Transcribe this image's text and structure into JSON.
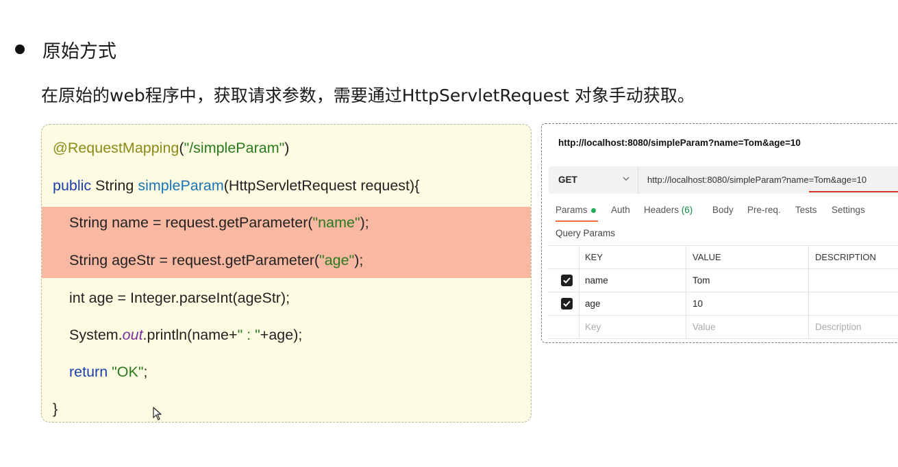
{
  "slide": {
    "heading": "原始方式",
    "description": "在原始的web程序中，获取请求参数，需要通过HttpServletRequest 对象手动获取。"
  },
  "code": {
    "line1_annotation": "@RequestMapping",
    "line1_paren_open": "(",
    "line1_string": "\"/simpleParam\"",
    "line1_paren_close": ")",
    "line2_kw": "public",
    "line2_type": " String ",
    "line2_method": "simpleParam",
    "line2_rest": "(HttpServletRequest request){",
    "line3_pre": "String name = request.getParameter(",
    "line3_str": "\"name\"",
    "line3_post": ");",
    "line4_pre": "String ageStr = request.getParameter(",
    "line4_str": "\"age\"",
    "line4_post": ");",
    "line5": "int age = Integer.parseInt(ageStr);",
    "line6_pre": "System.",
    "line6_field": "out",
    "line6_mid": ".println(name+",
    "line6_str": "\" : \"",
    "line6_post": "+age);",
    "line7_kw": "return",
    "line7_str": " \"OK\"",
    "line7_post": ";",
    "line8": "}"
  },
  "postman": {
    "title_url": "http://localhost:8080/simpleParam?name=Tom&age=10",
    "method": "GET",
    "url": "http://localhost:8080/simpleParam?name=Tom&age=10",
    "tabs": {
      "params": "Params",
      "auth": "Auth",
      "headers": "Headers",
      "headers_count": "(6)",
      "body": "Body",
      "prereq": "Pre-req.",
      "tests": "Tests",
      "settings": "Settings"
    },
    "query_params_label": "Query Params",
    "columns": {
      "key": "KEY",
      "value": "VALUE",
      "description": "DESCRIPTION"
    },
    "rows": [
      {
        "key": "name",
        "value": "Tom",
        "checked": true
      },
      {
        "key": "age",
        "value": "10",
        "checked": true
      }
    ],
    "placeholder": {
      "key": "Key",
      "value": "Value",
      "description": "Description"
    }
  }
}
